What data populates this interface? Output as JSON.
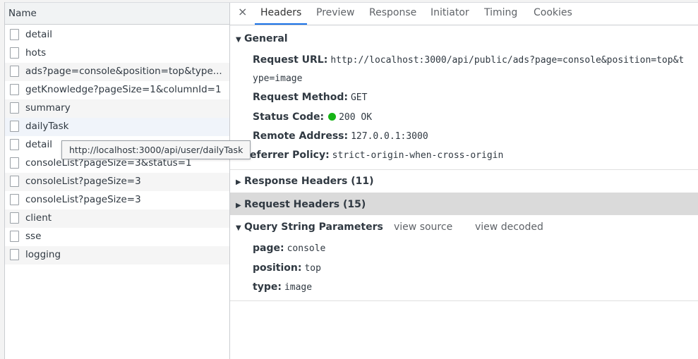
{
  "left_panel": {
    "header": "Name",
    "items": [
      {
        "label": "detail"
      },
      {
        "label": "hots"
      },
      {
        "label": "ads?page=console&position=top&type..."
      },
      {
        "label": "getKnowledge?pageSize=1&columnId=1"
      },
      {
        "label": "summary"
      },
      {
        "label": "dailyTask"
      },
      {
        "label": "detail"
      },
      {
        "label": "consoleList?pageSize=3&status=1"
      },
      {
        "label": "consoleList?pageSize=3"
      },
      {
        "label": "consoleList?pageSize=3"
      },
      {
        "label": "client"
      },
      {
        "label": "sse"
      },
      {
        "label": "logging"
      }
    ],
    "tooltip": "http://localhost:3000/api/user/dailyTask"
  },
  "tabs": {
    "close": "×",
    "items": [
      "Headers",
      "Preview",
      "Response",
      "Initiator",
      "Timing",
      "Cookies"
    ],
    "active": "Headers"
  },
  "general": {
    "title": "General",
    "request_url_key": "Request URL:",
    "request_url_value_line1": "http://localhost:3000/api/public/ads?page=console&position=top&t",
    "request_url_value_line2": "ype=image",
    "request_method_key": "Request Method:",
    "request_method_value": "GET",
    "status_code_key": "Status Code:",
    "status_code_value": "200 OK",
    "remote_address_key": "Remote Address:",
    "remote_address_value": "127.0.0.1:3000",
    "referrer_policy_key": "eferrer Policy:",
    "referrer_policy_value": "strict-origin-when-cross-origin"
  },
  "response_headers": {
    "title": "Response Headers (11)"
  },
  "request_headers": {
    "title": "Request Headers (15)"
  },
  "query_params": {
    "title": "Query String Parameters",
    "view_source": "view source",
    "view_decoded": "view decoded",
    "params": [
      {
        "key": "page:",
        "value": "console"
      },
      {
        "key": "position:",
        "value": "top"
      },
      {
        "key": "type:",
        "value": "image"
      }
    ]
  },
  "colors": {
    "accent": "#1a73e8",
    "status_ok": "#16b416",
    "selected_band": "#dadada"
  }
}
